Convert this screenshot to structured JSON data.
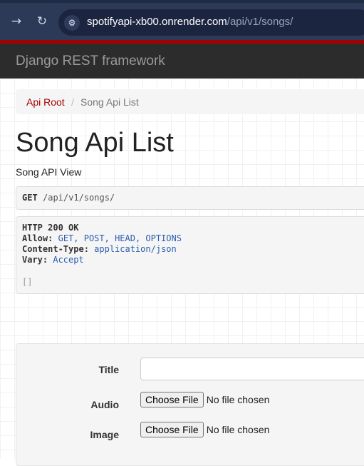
{
  "browser": {
    "url_host": "spotifyapi-xb00.onrender.com",
    "url_path": "/api/v1/songs/",
    "back_icon": "arrow-right-icon",
    "reload_icon": "reload-icon",
    "site_info_icon": "tune-icon"
  },
  "navbar": {
    "brand": "Django REST framework"
  },
  "breadcrumb": {
    "root": "Api Root",
    "separator": "/",
    "current": "Song Api List"
  },
  "page": {
    "title": "Song Api List",
    "description": "Song API View"
  },
  "request": {
    "method": "GET",
    "path": "/api/v1/songs/"
  },
  "response": {
    "status": "HTTP 200 OK",
    "headers": [
      {
        "key": "Allow:",
        "value": "GET, POST, HEAD, OPTIONS"
      },
      {
        "key": "Content-Type:",
        "value": "application/json"
      },
      {
        "key": "Vary:",
        "value": "Accept"
      }
    ],
    "body": "[]"
  },
  "form": {
    "title_label": "Title",
    "audio_label": "Audio",
    "image_label": "Image",
    "choose_file": "Choose File",
    "no_file": "No file chosen"
  },
  "colors": {
    "accent": "#a30000",
    "navbar": "#2c2c2c",
    "link_value": "#2a5db0"
  }
}
